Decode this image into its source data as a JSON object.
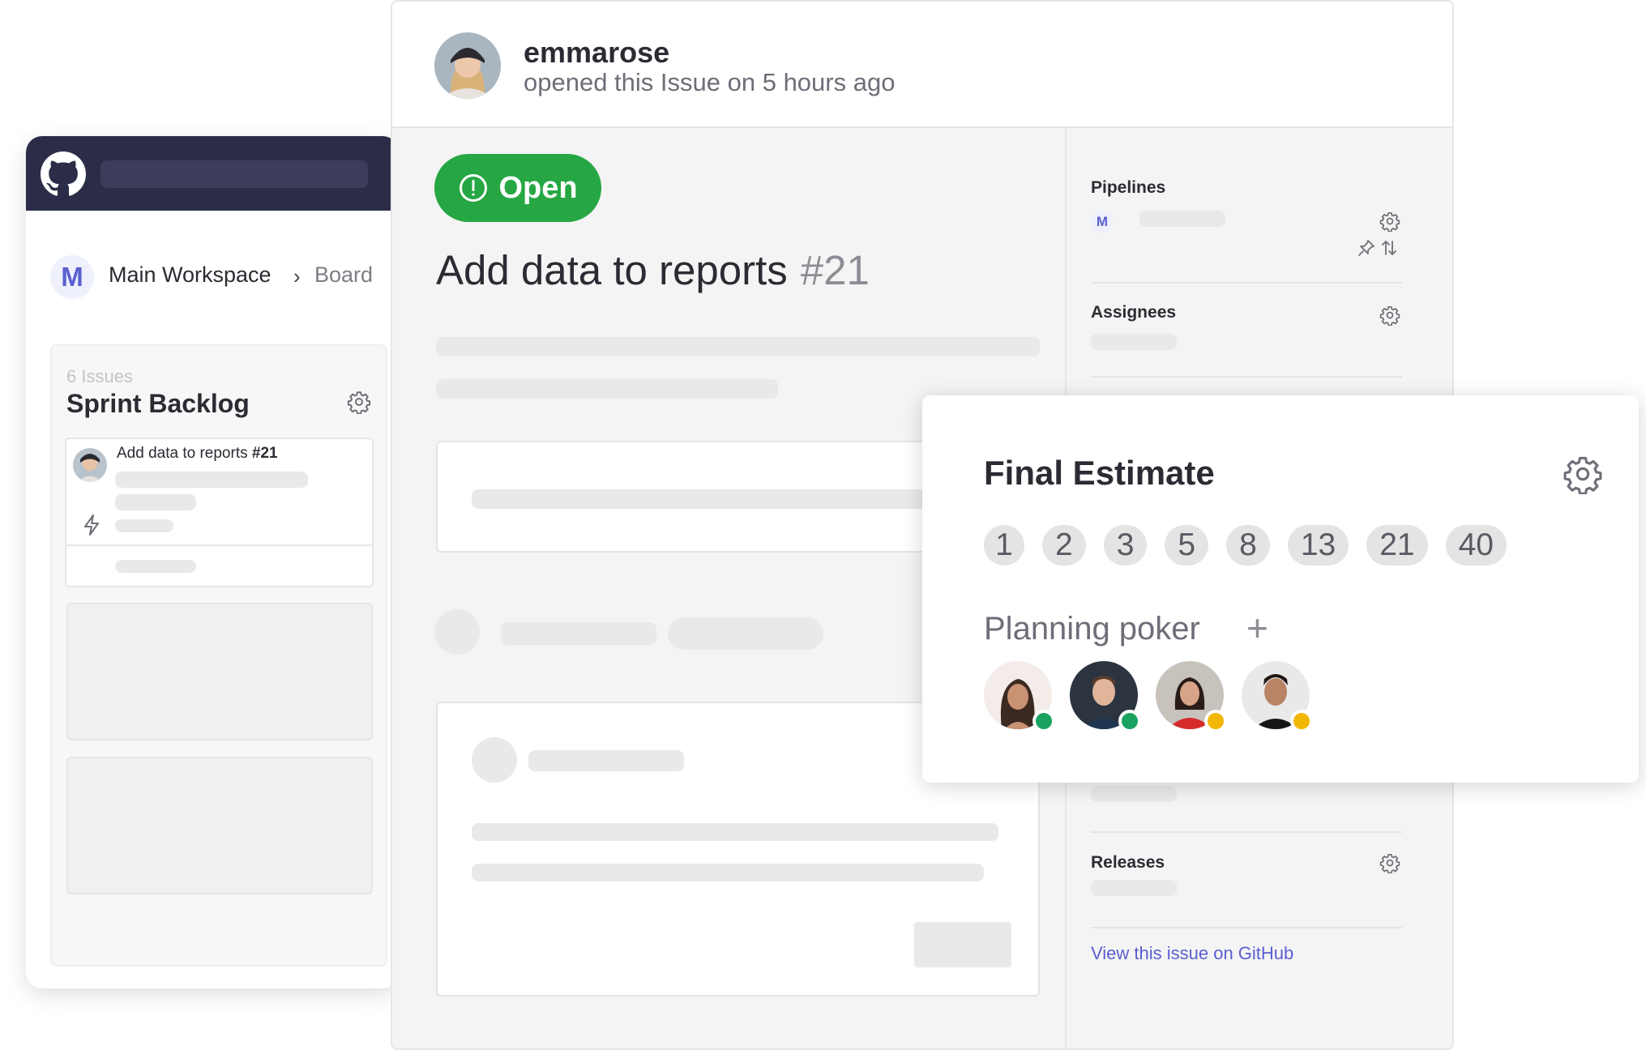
{
  "board": {
    "workspace_initial": "M",
    "workspace_name": "Main Workspace",
    "breadcrumb_separator": "›",
    "breadcrumb_current": "Board",
    "pipeline": {
      "issue_count": "6 Issues",
      "name": "Sprint Backlog",
      "card": {
        "title": "Add data to reports",
        "number": "#21"
      }
    }
  },
  "issue": {
    "author": "emmarose",
    "opened_text": "opened this Issue on 5 hours ago",
    "status": "Open",
    "title": "Add data to reports",
    "number": "#21",
    "colors": {
      "status_green": "#26a743",
      "accent": "#5a5fd0",
      "topbar": "#2b2d48"
    }
  },
  "sidebar": {
    "pipelines_label": "Pipelines",
    "pipeline_initial": "M",
    "assignees_label": "Assignees",
    "releases_label": "Releases",
    "github_link": "View this issue on GitHub"
  },
  "estimate": {
    "title": "Final Estimate",
    "options": [
      "1",
      "2",
      "3",
      "5",
      "8",
      "13",
      "21",
      "40"
    ],
    "poker_title": "Planning poker",
    "add_symbol": "+",
    "voters": [
      {
        "status": "voted",
        "status_color": "#1aa260"
      },
      {
        "status": "voted",
        "status_color": "#1aa260"
      },
      {
        "status": "pending",
        "status_color": "#f2b705"
      },
      {
        "status": "pending",
        "status_color": "#f2b705"
      }
    ]
  },
  "icons": [
    "github-logo-icon",
    "gear-icon",
    "lightning-bolt-icon",
    "alert-circle-icon",
    "pin-icon",
    "sort-arrows-icon",
    "plus-icon"
  ]
}
